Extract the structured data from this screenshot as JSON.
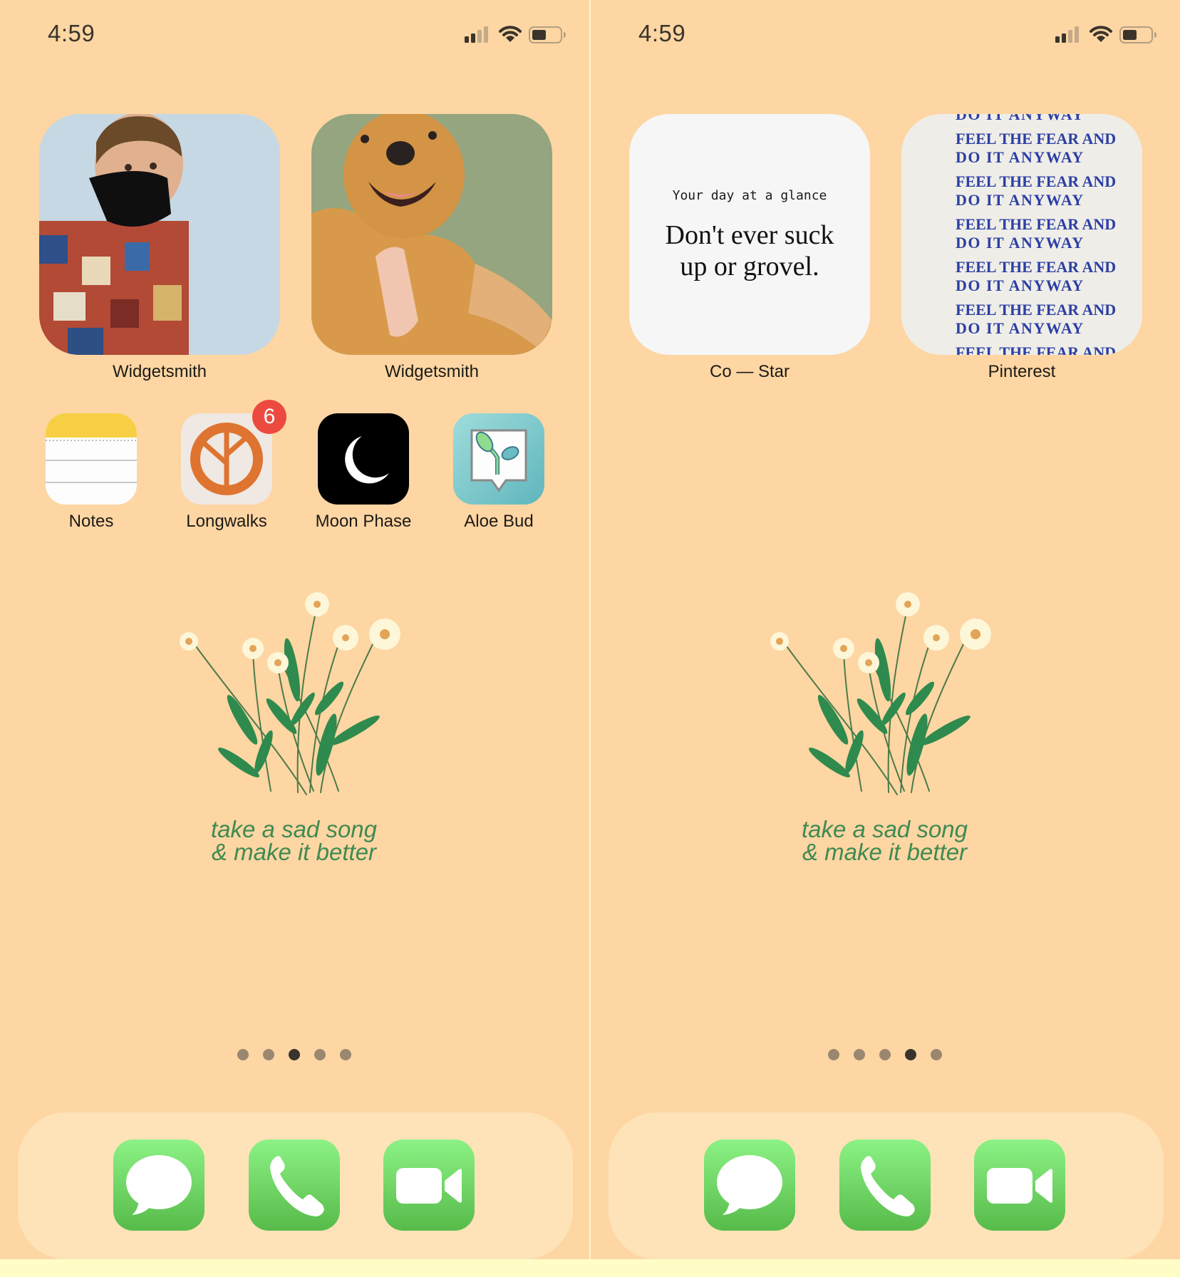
{
  "status_bar": {
    "time": "4:59",
    "signal_bars_active": 2,
    "signal_bars_total": 4,
    "battery_level_percent": 45
  },
  "screens": [
    {
      "page_index": 3,
      "page_count": 5,
      "widgets": [
        {
          "label": "Widgetsmith",
          "content": "photo of person in plaid shirt with black face mask on light blue background"
        },
        {
          "label": "Widgetsmith",
          "content": "photo of smiling golden dog being petted on green background"
        }
      ],
      "apps": [
        {
          "label": "Notes",
          "icon": "notes-icon"
        },
        {
          "label": "Longwalks",
          "icon": "leaf-circle-icon",
          "badge": "6"
        },
        {
          "label": "Moon Phase",
          "icon": "crescent-moon-icon"
        },
        {
          "label": "Aloe Bud",
          "icon": "sprout-bubble-icon"
        }
      ],
      "wallpaper_caption": [
        "take a sad song",
        "& make it better"
      ]
    },
    {
      "page_index": 4,
      "page_count": 5,
      "widgets": [
        {
          "label": "Co — Star",
          "heading": "Your day at a glance",
          "quote": [
            "Don't ever suck",
            "up or grovel."
          ]
        },
        {
          "label": "Pinterest",
          "lines": [
            "DO IT ANYWAY",
            "FEEL THE FEAR AND",
            "DO IT ANYWAY",
            "FEEL THE FEAR AND",
            "DO IT ANYWAY",
            "FEEL THE FEAR AND",
            "DO IT ANYWAY",
            "FEEL THE FEAR AND",
            "DO IT ANYWAY",
            "FEEL THE FEAR AND",
            "DO IT ANYWAY",
            "FEEL THE FEAR AND"
          ]
        }
      ],
      "wallpaper_caption": [
        "take a sad song",
        "& make it better"
      ]
    }
  ],
  "dock": [
    {
      "name": "Messages",
      "icon": "speech-bubble-icon"
    },
    {
      "name": "Phone",
      "icon": "phone-handset-icon"
    },
    {
      "name": "FaceTime",
      "icon": "video-camera-icon"
    }
  ],
  "colors": {
    "background": "#fdd6a3",
    "dock": "#fee3b8",
    "caption_green": "#3f8a52",
    "badge_red": "#ec4a3f",
    "pinterest_blue": "#2c3fa3",
    "dock_icon_green": "#57bb4a"
  }
}
